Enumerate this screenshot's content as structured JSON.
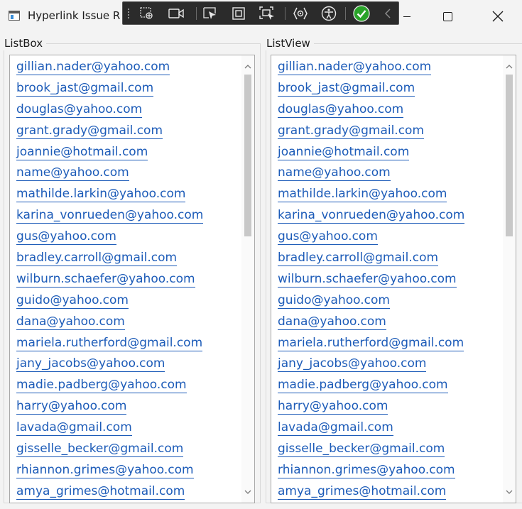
{
  "window": {
    "title": "Hyperlink Issue R",
    "minimize_icon": "minimize-icon",
    "maximize_icon": "maximize-icon",
    "close_icon": "close-icon"
  },
  "debug_toolbar": {
    "icons": [
      "select-element-icon",
      "record-video-icon",
      "pointer-select-icon",
      "layout-adorners-icon",
      "track-focus-icon",
      "hot-reload-icon",
      "accessibility-icon",
      "binding-check-icon",
      "collapse-chevron-icon"
    ],
    "check_color": "#29a329"
  },
  "listbox": {
    "label": "ListBox",
    "items": [
      "gillian.nader@yahoo.com",
      "brook_jast@gmail.com",
      "douglas@yahoo.com",
      "grant.grady@gmail.com",
      "joannie@hotmail.com",
      "name@yahoo.com",
      "mathilde.larkin@yahoo.com",
      "karina_vonrueden@yahoo.com",
      "gus@yahoo.com",
      "bradley.carroll@gmail.com",
      "wilburn.schaefer@yahoo.com",
      "guido@yahoo.com",
      "dana@yahoo.com",
      "mariela.rutherford@gmail.com",
      "jany_jacobs@yahoo.com",
      "madie.padberg@yahoo.com",
      "harry@yahoo.com",
      "lavada@gmail.com",
      "gisselle_becker@gmail.com",
      "rhiannon.grimes@yahoo.com",
      "amya_grimes@hotmail.com"
    ]
  },
  "listview": {
    "label": "ListView",
    "items": [
      "gillian.nader@yahoo.com",
      "brook_jast@gmail.com",
      "douglas@yahoo.com",
      "grant.grady@gmail.com",
      "joannie@hotmail.com",
      "name@yahoo.com",
      "mathilde.larkin@yahoo.com",
      "karina_vonrueden@yahoo.com",
      "gus@yahoo.com",
      "bradley.carroll@gmail.com",
      "wilburn.schaefer@yahoo.com",
      "guido@yahoo.com",
      "dana@yahoo.com",
      "mariela.rutherford@gmail.com",
      "jany_jacobs@yahoo.com",
      "madie.padberg@yahoo.com",
      "harry@yahoo.com",
      "lavada@gmail.com",
      "gisselle_becker@gmail.com",
      "rhiannon.grimes@yahoo.com",
      "amya_grimes@hotmail.com"
    ]
  },
  "colors": {
    "hyperlink": "#1c5bb8",
    "scroll_thumb": "#c8c8c8",
    "window_background": "#f3f3f3"
  }
}
